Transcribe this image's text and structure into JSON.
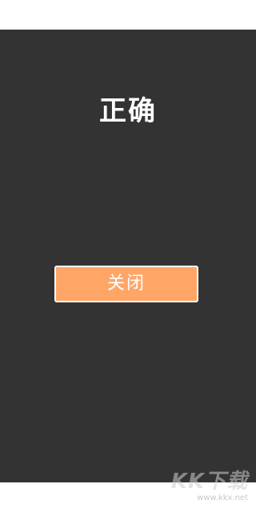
{
  "result": {
    "title": "正确"
  },
  "actions": {
    "close_label": "关闭"
  },
  "watermark": {
    "logo_text": "KK下载",
    "url": "www.kkx.net"
  },
  "colors": {
    "panel_background": "#333333",
    "button_background": "#ffa667",
    "button_border": "#ffffff",
    "title_text": "#ffffff"
  }
}
